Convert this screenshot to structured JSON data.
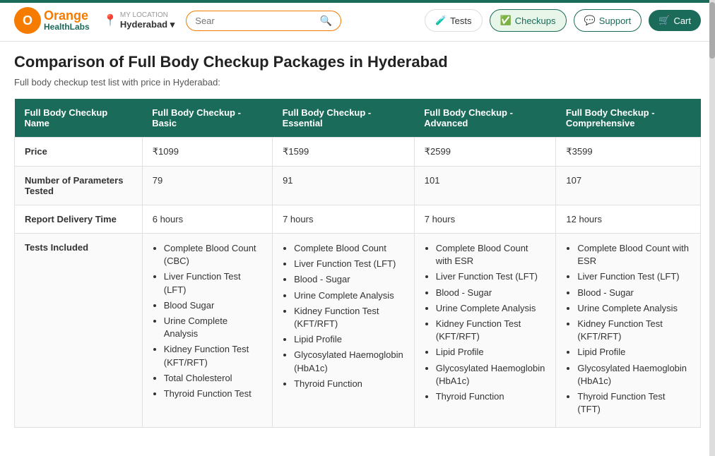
{
  "header": {
    "logo_orange": "Orange",
    "logo_health": "HealthLabs",
    "location_label": "MY LOCATION",
    "location_city": "Hyderabad",
    "search_placeholder": "Sear",
    "nav_tests": "Tests",
    "nav_checkups": "Checkups",
    "nav_support": "Support",
    "nav_cart": "Cart"
  },
  "page": {
    "title": "Comparison of Full Body Checkup Packages in Hyderabad",
    "subtitle": "Full body checkup test list with price in Hyderabad:"
  },
  "table": {
    "headers": [
      "Full Body Checkup Name",
      "Full Body Checkup - Basic",
      "Full Body Checkup - Essential",
      "Full Body Checkup - Advanced",
      "Full Body Checkup - Comprehensive"
    ],
    "rows": [
      {
        "label": "Price",
        "values": [
          "₹1099",
          "₹1599",
          "₹2599",
          "₹3599"
        ]
      },
      {
        "label": "Number of Parameters Tested",
        "values": [
          "79",
          "91",
          "101",
          "107"
        ]
      },
      {
        "label": "Report Delivery Time",
        "values": [
          "6 hours",
          "7 hours",
          "7 hours",
          "12 hours"
        ]
      },
      {
        "label": "Tests Included",
        "values": [
          [
            "Complete Blood Count (CBC)",
            "Liver Function Test (LFT)",
            "Blood Sugar",
            "Urine Complete Analysis",
            "Kidney Function Test (KFT/RFT)",
            "Total Cholesterol",
            "Thyroid Function Test"
          ],
          [
            "Complete Blood Count",
            "Liver Function Test (LFT)",
            "Blood - Sugar",
            "Urine Complete Analysis",
            "Kidney Function Test (KFT/RFT)",
            "Lipid Profile",
            "Glycosylated Haemoglobin (HbA1c)",
            "Thyroid Function"
          ],
          [
            "Complete Blood Count with ESR",
            "Liver Function Test (LFT)",
            "Blood - Sugar",
            "Urine Complete Analysis",
            "Kidney Function Test (KFT/RFT)",
            "Lipid Profile",
            "Glycosylated Haemoglobin (HbA1c)",
            "Thyroid Function"
          ],
          [
            "Complete Blood Count with ESR",
            "Liver Function Test (LFT)",
            "Blood - Sugar",
            "Urine Complete Analysis",
            "Kidney Function Test (KFT/RFT)",
            "Lipid Profile",
            "Glycosylated Haemoglobin (HbA1c)",
            "Thyroid Function Test (TFT)"
          ]
        ]
      }
    ]
  }
}
